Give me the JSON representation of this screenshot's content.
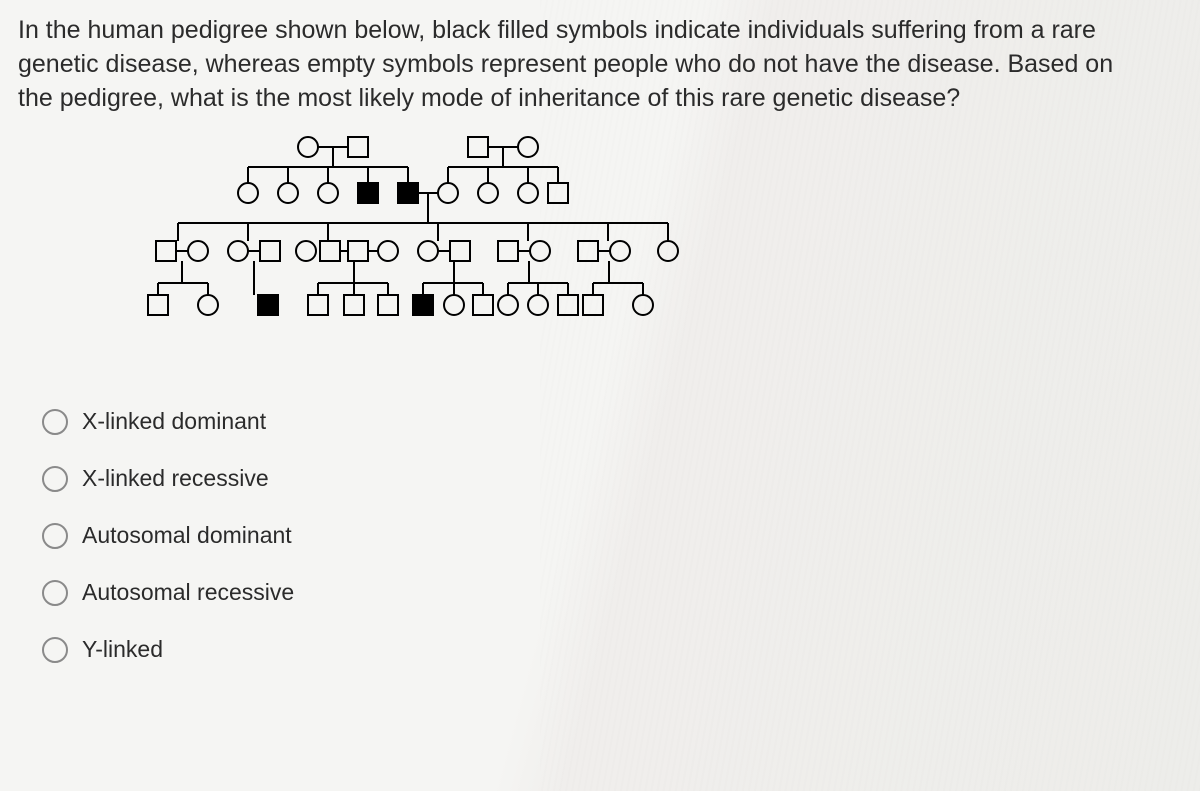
{
  "question": "In the human pedigree shown below, black filled symbols indicate individuals suffering from a rare genetic disease, whereas empty symbols represent people who do not have the disease. Based on the pedigree, what is the most likely mode of inheritance of this rare genetic disease?",
  "options": [
    "X-linked dominant",
    "X-linked recessive",
    "Autosomal dominant",
    "Autosomal recessive",
    "Y-linked"
  ],
  "pedigree_shapes": {
    "circle_open": "unaffected female",
    "square_open": "unaffected male",
    "square_filled": "affected male"
  },
  "chart_data": {
    "type": "pedigree",
    "generations": [
      {
        "gen": 1,
        "couples": [
          {
            "id": "A",
            "left": {
              "sex": "F",
              "affected": false
            },
            "right": {
              "sex": "M",
              "affected": false
            }
          },
          {
            "id": "B",
            "left": {
              "sex": "M",
              "affected": false
            },
            "right": {
              "sex": "F",
              "affected": false
            }
          }
        ]
      },
      {
        "gen": 2,
        "individuals": [
          {
            "parent": "A",
            "sex": "F",
            "affected": false
          },
          {
            "parent": "A",
            "sex": "F",
            "affected": false
          },
          {
            "parent": "A",
            "sex": "F",
            "affected": false
          },
          {
            "parent": "A",
            "sex": "M",
            "affected": true
          },
          {
            "parent": "A",
            "sex": "M",
            "affected": true,
            "mate": {
              "sex": "F",
              "affected": false,
              "from": "B"
            }
          },
          {
            "parent": "B",
            "sex": "F",
            "affected": false
          },
          {
            "parent": "B",
            "sex": "F",
            "affected": false
          },
          {
            "parent": "B",
            "sex": "M",
            "affected": false
          }
        ]
      },
      {
        "gen": 3,
        "couples": [
          {
            "id": "C1",
            "left": {
              "sex": "M",
              "affected": false
            },
            "right": {
              "sex": "F",
              "affected": false
            }
          },
          {
            "id": "C2",
            "left": {
              "sex": "F",
              "affected": false
            },
            "right": {
              "sex": "M",
              "affected": false
            }
          },
          {
            "id": "C3",
            "left": {
              "sex": "F",
              "affected": false
            },
            "right": {
              "sex": "M",
              "affected": false
            }
          },
          {
            "id": "C4",
            "left": {
              "sex": "M",
              "affected": false
            },
            "right": {
              "sex": "F",
              "affected": false
            }
          },
          {
            "id": "C5",
            "left": {
              "sex": "F",
              "affected": false
            },
            "right": {
              "sex": "M",
              "affected": false
            }
          },
          {
            "id": "C6",
            "left": {
              "sex": "M",
              "affected": false
            },
            "right": {
              "sex": "F",
              "affected": false
            }
          },
          {
            "id": "C7",
            "left": {
              "sex": "M",
              "affected": false
            },
            "right": {
              "sex": "F",
              "affected": false
            }
          }
        ]
      },
      {
        "gen": 4,
        "individuals": [
          {
            "parent": "C1",
            "sex": "M",
            "affected": false
          },
          {
            "parent": "C1",
            "sex": "F",
            "affected": false
          },
          {
            "parent": "C2",
            "sex": "M",
            "affected": true
          },
          {
            "parent": "C3",
            "sex": "M",
            "affected": false
          },
          {
            "parent": "C3",
            "sex": "M",
            "affected": false
          },
          {
            "parent": "C4",
            "sex": "M",
            "affected": false
          },
          {
            "parent": "C4",
            "sex": "M",
            "affected": true
          },
          {
            "parent": "C5",
            "sex": "F",
            "affected": false
          },
          {
            "parent": "C5",
            "sex": "M",
            "affected": false
          },
          {
            "parent": "C5",
            "sex": "F",
            "affected": false
          },
          {
            "parent": "C6",
            "sex": "F",
            "affected": false
          },
          {
            "parent": "C6",
            "sex": "M",
            "affected": false
          },
          {
            "parent": "C7",
            "sex": "F",
            "affected": false
          }
        ]
      }
    ]
  }
}
